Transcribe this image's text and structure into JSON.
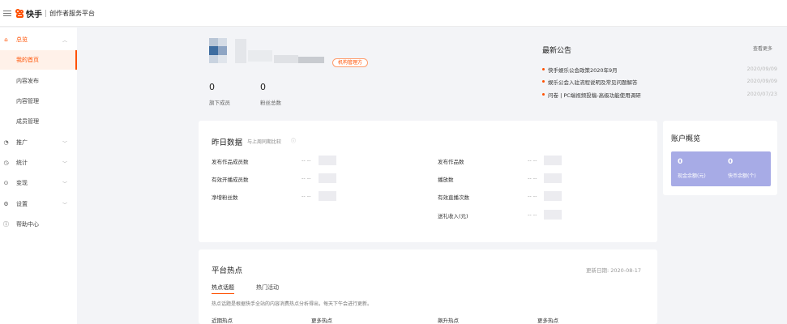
{
  "header": {
    "brand": "快手",
    "platform": "创作者服务平台"
  },
  "sidebar": {
    "items": [
      {
        "label": "总览",
        "icon": "home-icon",
        "expanded": true
      },
      {
        "label": "我的首页",
        "sub": true,
        "selected": true
      },
      {
        "label": "内容发布",
        "sub": true
      },
      {
        "label": "内容管理",
        "sub": true
      },
      {
        "label": "成员管理",
        "sub": true
      },
      {
        "label": "推广",
        "icon": "flame-icon"
      },
      {
        "label": "统计",
        "icon": "chart-icon"
      },
      {
        "label": "变现",
        "icon": "money-icon"
      },
      {
        "label": "设置",
        "icon": "gear-icon"
      },
      {
        "label": "帮助中心",
        "icon": "help-icon"
      }
    ]
  },
  "profile": {
    "role": "机构管理方",
    "stats": [
      {
        "value": "0",
        "label": "旗下成员"
      },
      {
        "value": "0",
        "label": "粉丝总数"
      }
    ]
  },
  "announcements": {
    "title": "最新公告",
    "more": "查看更多",
    "items": [
      {
        "text": "快手娱乐公会政策2020年9月",
        "date": "2020/09/09"
      },
      {
        "text": "娱乐公会入驻流程说明及常见问题解答",
        "date": "2020/09/09"
      },
      {
        "text": "问卷 | PC端视频投稿-高级功能使用调研",
        "date": "2020/07/23"
      }
    ]
  },
  "yesterday": {
    "title": "昨日数据",
    "subtitle": "与上周同期比较",
    "left": [
      {
        "label": "发布作品成员数",
        "value": "-- --"
      },
      {
        "label": "有效开播成员数",
        "value": "-- --"
      },
      {
        "label": "净增粉丝数",
        "value": "-- --"
      }
    ],
    "right": [
      {
        "label": "发布作品数",
        "value": "-- --"
      },
      {
        "label": "播放数",
        "value": "-- --"
      },
      {
        "label": "有效直播次数",
        "value": "-- --"
      },
      {
        "label": "送礼收入(元)",
        "value": "-- --"
      }
    ]
  },
  "account": {
    "title": "账户概览",
    "items": [
      {
        "value": "0",
        "label": "现金余额(元)"
      },
      {
        "value": "0",
        "label": "快币余额(个)"
      }
    ],
    "color": "#a7abe6"
  },
  "hot": {
    "title": "平台热点",
    "updated": "更新日期: 2020-08-17",
    "tabs": [
      "热点话题",
      "热门活动"
    ],
    "description": "热点话题是根据快手全站的内容消费热点分析得出，每天下午会进行更新。",
    "columns": [
      "近期热点",
      "更多热点",
      "飙升热点",
      "更多热点"
    ]
  },
  "colors": {
    "accent": "#ff5000",
    "background": "#f3f4f7"
  }
}
